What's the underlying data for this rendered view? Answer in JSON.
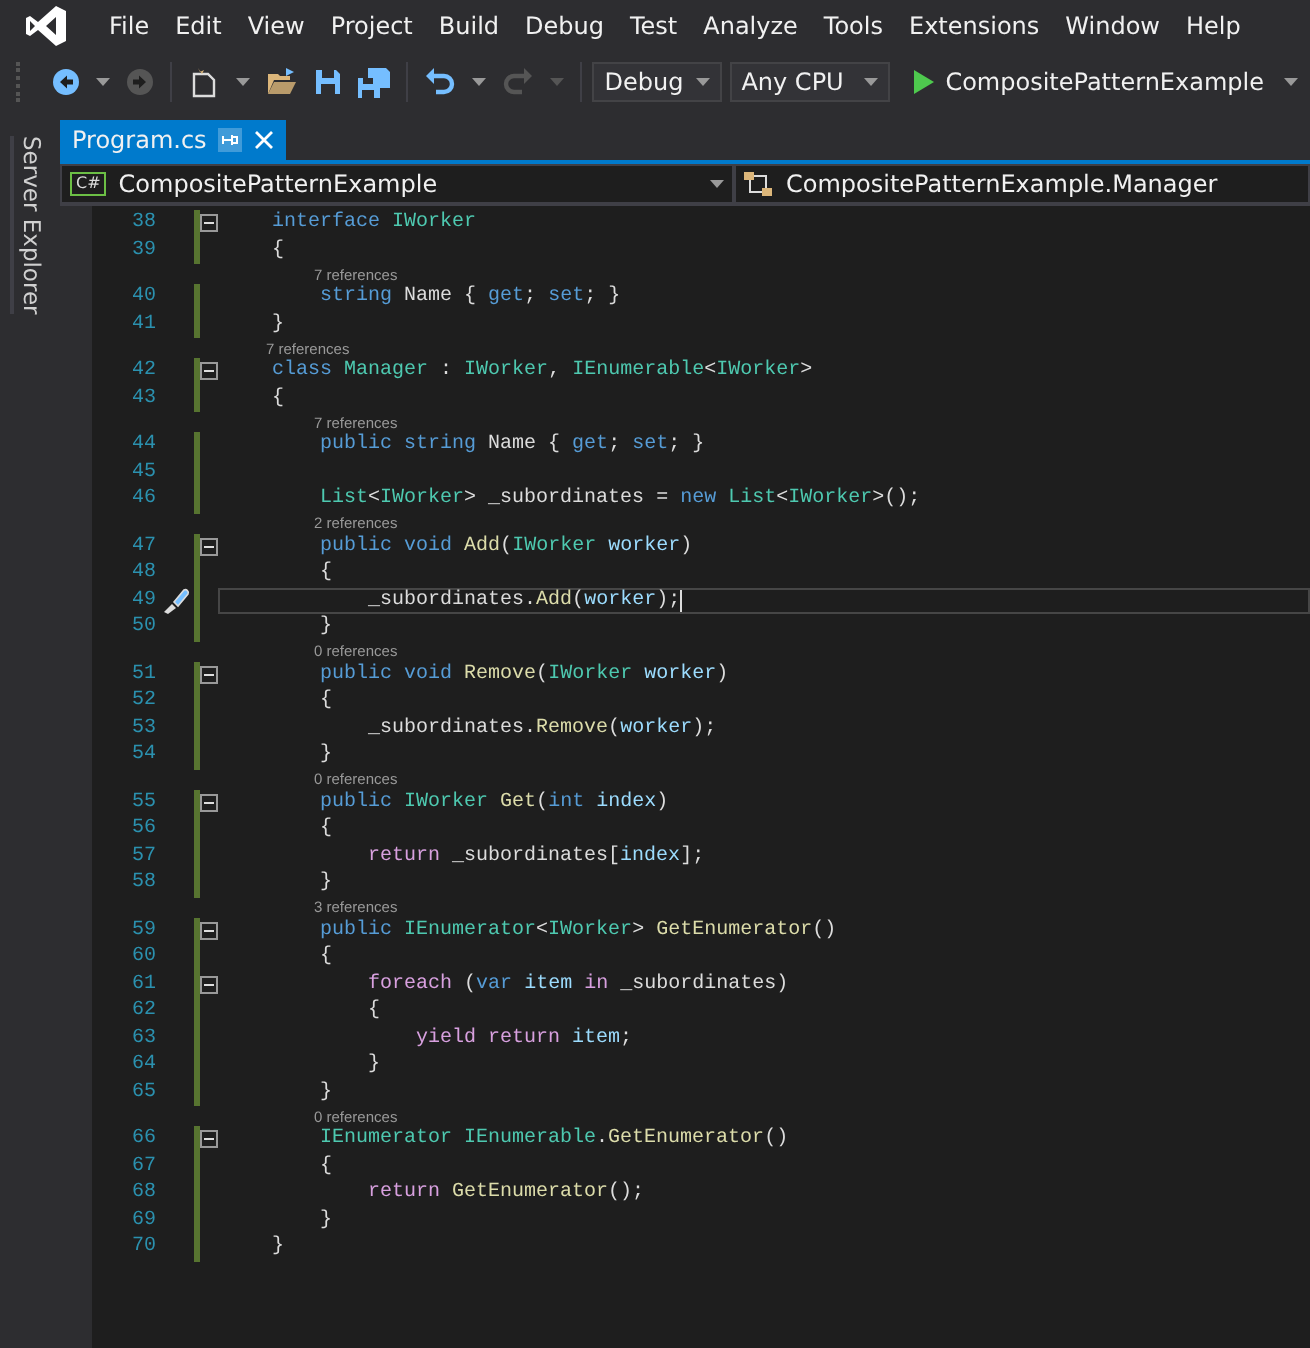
{
  "menu": [
    "File",
    "Edit",
    "View",
    "Project",
    "Build",
    "Debug",
    "Test",
    "Analyze",
    "Tools",
    "Extensions",
    "Window",
    "Help"
  ],
  "toolbar": {
    "groups": [
      [
        {
          "kind": "back",
          "disabled": false
        },
        {
          "kind": "caret",
          "disabled": false
        },
        {
          "kind": "forward",
          "disabled": true
        }
      ],
      [
        {
          "kind": "new",
          "disabled": false
        },
        {
          "kind": "caret",
          "disabled": false
        },
        {
          "kind": "open",
          "disabled": false
        },
        {
          "kind": "save",
          "disabled": false
        },
        {
          "kind": "saveall",
          "disabled": false
        }
      ],
      [
        {
          "kind": "undo",
          "disabled": false
        },
        {
          "kind": "caret",
          "disabled": false
        },
        {
          "kind": "redo",
          "disabled": true
        },
        {
          "kind": "caret",
          "disabled": true
        }
      ]
    ],
    "configuration": "Debug",
    "platform": "Any CPU",
    "start_target": "CompositePatternExample"
  },
  "side_tabs": [
    {
      "label": "Server Explorer"
    }
  ],
  "tabs": [
    {
      "label": "Program.cs",
      "selected": true
    }
  ],
  "nav_bar": {
    "file_badge": "C#",
    "project": "CompositePatternExample",
    "member": "CompositePatternExample.Manager"
  },
  "editor": {
    "lines": [
      {
        "number": "38",
        "fold": true,
        "current": false,
        "tokens": [
          {
            "kind": "keyword",
            "text": "    interface "
          },
          {
            "kind": "type",
            "text": "IWorker"
          }
        ]
      },
      {
        "number": "39",
        "fold": false,
        "current": false,
        "tokens": [
          {
            "kind": "plain",
            "text": "    {"
          }
        ]
      },
      {
        "number": "40",
        "lens": "7 references",
        "fold": false,
        "current": false,
        "tokens": [
          {
            "kind": "keyword",
            "text": "        string"
          },
          {
            "kind": "plain",
            "text": " Name { "
          },
          {
            "kind": "keyword",
            "text": "get"
          },
          {
            "kind": "plain",
            "text": "; "
          },
          {
            "kind": "keyword",
            "text": "set"
          },
          {
            "kind": "plain",
            "text": "; }"
          }
        ]
      },
      {
        "number": "41",
        "fold": false,
        "current": false,
        "tokens": [
          {
            "kind": "plain",
            "text": "    }"
          }
        ]
      },
      {
        "number": "42",
        "lens": "7 references",
        "fold": true,
        "current": false,
        "tokens": [
          {
            "kind": "keyword",
            "text": "    class "
          },
          {
            "kind": "type",
            "text": "Manager"
          },
          {
            "kind": "plain",
            "text": " : "
          },
          {
            "kind": "type",
            "text": "IWorker"
          },
          {
            "kind": "plain",
            "text": ", "
          },
          {
            "kind": "type",
            "text": "IEnumerable"
          },
          {
            "kind": "plain",
            "text": "<"
          },
          {
            "kind": "type",
            "text": "IWorker"
          },
          {
            "kind": "plain",
            "text": ">"
          }
        ]
      },
      {
        "number": "43",
        "fold": false,
        "current": false,
        "tokens": [
          {
            "kind": "plain",
            "text": "    {"
          }
        ]
      },
      {
        "number": "44",
        "lens": "7 references",
        "fold": false,
        "current": false,
        "tokens": [
          {
            "kind": "keyword",
            "text": "        public string"
          },
          {
            "kind": "plain",
            "text": " Name { "
          },
          {
            "kind": "keyword",
            "text": "get"
          },
          {
            "kind": "plain",
            "text": "; "
          },
          {
            "kind": "keyword",
            "text": "set"
          },
          {
            "kind": "plain",
            "text": "; }"
          }
        ]
      },
      {
        "number": "45",
        "fold": false,
        "current": false
      },
      {
        "number": "46",
        "fold": false,
        "current": false,
        "tokens": [
          {
            "kind": "type",
            "text": "        List"
          },
          {
            "kind": "plain",
            "text": "<"
          },
          {
            "kind": "type",
            "text": "IWorker"
          },
          {
            "kind": "plain",
            "text": "> _subordinates = "
          },
          {
            "kind": "keyword",
            "text": "new "
          },
          {
            "kind": "type",
            "text": "List"
          },
          {
            "kind": "plain",
            "text": "<"
          },
          {
            "kind": "type",
            "text": "IWorker"
          },
          {
            "kind": "plain",
            "text": ">();"
          }
        ]
      },
      {
        "number": "47",
        "lens": "2 references",
        "fold": true,
        "current": false,
        "tokens": [
          {
            "kind": "keyword",
            "text": "        public void "
          },
          {
            "kind": "method",
            "text": "Add"
          },
          {
            "kind": "plain",
            "text": "("
          },
          {
            "kind": "type",
            "text": "IWorker "
          },
          {
            "kind": "parameter",
            "text": "worker"
          },
          {
            "kind": "plain",
            "text": ")"
          }
        ]
      },
      {
        "number": "48",
        "fold": false,
        "current": false,
        "tokens": [
          {
            "kind": "plain",
            "text": "        {"
          }
        ]
      },
      {
        "number": "49",
        "fold": false,
        "current": true,
        "tokens": [
          {
            "kind": "plain",
            "text": "            _subordinates."
          },
          {
            "kind": "method",
            "text": "Add"
          },
          {
            "kind": "plain",
            "text": "("
          },
          {
            "kind": "parameter",
            "text": "worker"
          },
          {
            "kind": "plain",
            "text": ");"
          }
        ]
      },
      {
        "number": "50",
        "fold": false,
        "current": false,
        "tokens": [
          {
            "kind": "plain",
            "text": "        }"
          }
        ]
      },
      {
        "number": "51",
        "lens": "0 references",
        "fold": true,
        "current": false,
        "tokens": [
          {
            "kind": "keyword",
            "text": "        public void "
          },
          {
            "kind": "method",
            "text": "Remove"
          },
          {
            "kind": "plain",
            "text": "("
          },
          {
            "kind": "type",
            "text": "IWorker "
          },
          {
            "kind": "parameter",
            "text": "worker"
          },
          {
            "kind": "plain",
            "text": ")"
          }
        ]
      },
      {
        "number": "52",
        "fold": false,
        "current": false,
        "tokens": [
          {
            "kind": "plain",
            "text": "        {"
          }
        ]
      },
      {
        "number": "53",
        "fold": false,
        "current": false,
        "tokens": [
          {
            "kind": "plain",
            "text": "            _subordinates."
          },
          {
            "kind": "method",
            "text": "Remove"
          },
          {
            "kind": "plain",
            "text": "("
          },
          {
            "kind": "parameter",
            "text": "worker"
          },
          {
            "kind": "plain",
            "text": ");"
          }
        ]
      },
      {
        "number": "54",
        "fold": false,
        "current": false,
        "tokens": [
          {
            "kind": "plain",
            "text": "        }"
          }
        ]
      },
      {
        "number": "55",
        "lens": "0 references",
        "fold": true,
        "current": false,
        "tokens": [
          {
            "kind": "keyword",
            "text": "        public "
          },
          {
            "kind": "type",
            "text": "IWorker "
          },
          {
            "kind": "method",
            "text": "Get"
          },
          {
            "kind": "plain",
            "text": "("
          },
          {
            "kind": "keyword",
            "text": "int "
          },
          {
            "kind": "parameter",
            "text": "index"
          },
          {
            "kind": "plain",
            "text": ")"
          }
        ]
      },
      {
        "number": "56",
        "fold": false,
        "current": false,
        "tokens": [
          {
            "kind": "plain",
            "text": "        {"
          }
        ]
      },
      {
        "number": "57",
        "fold": false,
        "current": false,
        "tokens": [
          {
            "kind": "control",
            "text": "            return"
          },
          {
            "kind": "plain",
            "text": " _subordinates["
          },
          {
            "kind": "parameter",
            "text": "index"
          },
          {
            "kind": "plain",
            "text": "];"
          }
        ]
      },
      {
        "number": "58",
        "fold": false,
        "current": false,
        "tokens": [
          {
            "kind": "plain",
            "text": "        }"
          }
        ]
      },
      {
        "number": "59",
        "lens": "3 references",
        "fold": true,
        "current": false,
        "tokens": [
          {
            "kind": "keyword",
            "text": "        public "
          },
          {
            "kind": "type",
            "text": "IEnumerator"
          },
          {
            "kind": "plain",
            "text": "<"
          },
          {
            "kind": "type",
            "text": "IWorker"
          },
          {
            "kind": "plain",
            "text": "> "
          },
          {
            "kind": "method",
            "text": "GetEnumerator"
          },
          {
            "kind": "plain",
            "text": "()"
          }
        ]
      },
      {
        "number": "60",
        "fold": false,
        "current": false,
        "tokens": [
          {
            "kind": "plain",
            "text": "        {"
          }
        ]
      },
      {
        "number": "61",
        "fold": true,
        "current": false,
        "tokens": [
          {
            "kind": "control",
            "text": "            foreach"
          },
          {
            "kind": "plain",
            "text": " ("
          },
          {
            "kind": "keyword",
            "text": "var "
          },
          {
            "kind": "parameter",
            "text": "item "
          },
          {
            "kind": "control",
            "text": "in"
          },
          {
            "kind": "plain",
            "text": " _subordinates)"
          }
        ]
      },
      {
        "number": "62",
        "fold": false,
        "current": false,
        "tokens": [
          {
            "kind": "plain",
            "text": "            {"
          }
        ]
      },
      {
        "number": "63",
        "fold": false,
        "current": false,
        "tokens": [
          {
            "kind": "control",
            "text": "                yield return "
          },
          {
            "kind": "parameter",
            "text": "item"
          },
          {
            "kind": "plain",
            "text": ";"
          }
        ]
      },
      {
        "number": "64",
        "fold": false,
        "current": false,
        "tokens": [
          {
            "kind": "plain",
            "text": "            }"
          }
        ]
      },
      {
        "number": "65",
        "fold": false,
        "current": false,
        "tokens": [
          {
            "kind": "plain",
            "text": "        }"
          }
        ]
      },
      {
        "number": "66",
        "lens": "0 references",
        "fold": true,
        "current": false,
        "tokens": [
          {
            "kind": "type",
            "text": "        IEnumerator IEnumerable"
          },
          {
            "kind": "plain",
            "text": "."
          },
          {
            "kind": "method",
            "text": "GetEnumerator"
          },
          {
            "kind": "plain",
            "text": "()"
          }
        ]
      },
      {
        "number": "67",
        "fold": false,
        "current": false,
        "tokens": [
          {
            "kind": "plain",
            "text": "        {"
          }
        ]
      },
      {
        "number": "68",
        "fold": false,
        "current": false,
        "tokens": [
          {
            "kind": "control",
            "text": "            return "
          },
          {
            "kind": "method",
            "text": "GetEnumerator"
          },
          {
            "kind": "plain",
            "text": "();"
          }
        ]
      },
      {
        "number": "69",
        "fold": false,
        "current": false,
        "tokens": [
          {
            "kind": "plain",
            "text": "        }"
          }
        ]
      },
      {
        "number": "70",
        "fold": false,
        "current": false,
        "tokens": [
          {
            "kind": "plain",
            "text": "    }"
          }
        ]
      }
    ]
  }
}
